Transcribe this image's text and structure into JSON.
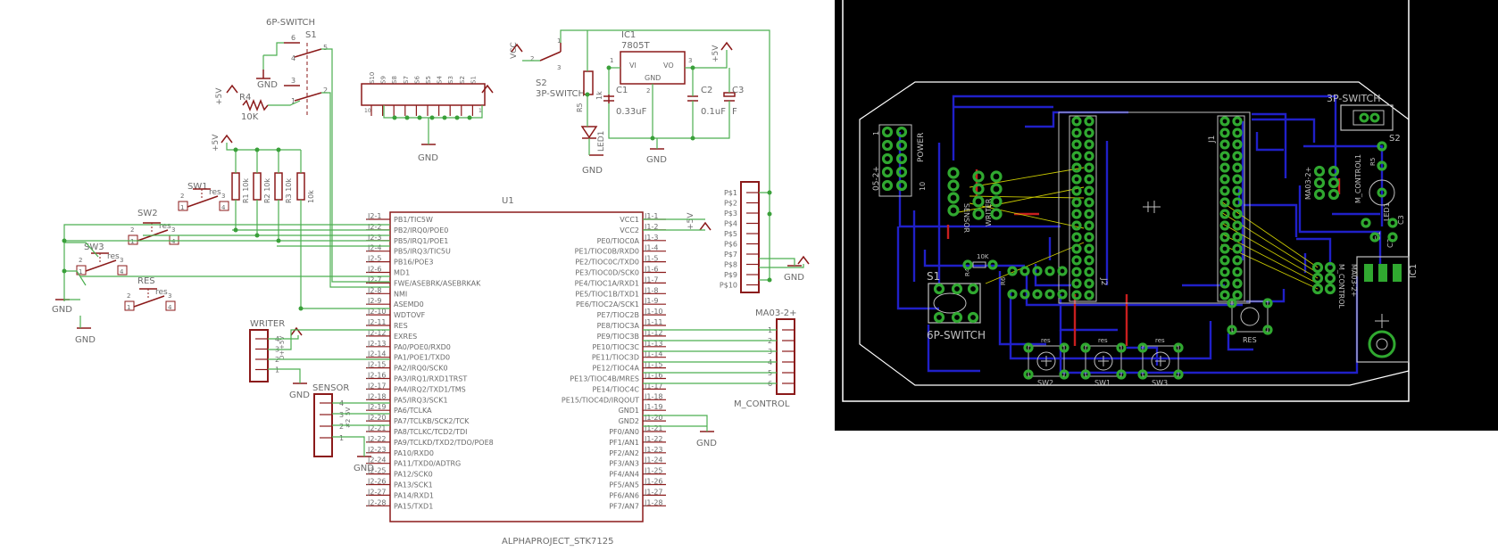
{
  "schematic": {
    "u1_ref": "U1",
    "u1_value": "ALPHAPROJECT_STK7125",
    "u1_left_pins": [
      {
        "num": "J2-1",
        "name": "PB1/TIC5W"
      },
      {
        "num": "J2-2",
        "name": "PB2/IRQ0/POE0"
      },
      {
        "num": "J2-3",
        "name": "PB5/IRQ1/POE1"
      },
      {
        "num": "J2-4",
        "name": "PB5/IRQ3/TIC5U"
      },
      {
        "num": "J2-5",
        "name": "PB16/POE3"
      },
      {
        "num": "J2-6",
        "name": "MD1"
      },
      {
        "num": "J2-7",
        "name": "FWE/ASEBRK/ASEBRKAK"
      },
      {
        "num": "J2-8",
        "name": "NMI"
      },
      {
        "num": "J2-9",
        "name": "ASEMD0"
      },
      {
        "num": "J2-10",
        "name": "WDTOVF"
      },
      {
        "num": "J2-11",
        "name": "RES"
      },
      {
        "num": "J2-12",
        "name": "EXRES"
      },
      {
        "num": "J2-13",
        "name": "PA0/POE0/RXD0"
      },
      {
        "num": "J2-14",
        "name": "PA1/POE1/TXD0"
      },
      {
        "num": "J2-15",
        "name": "PA2/IRQ0/SCK0"
      },
      {
        "num": "J2-16",
        "name": "PA3/IRQ1/RXD1TRST"
      },
      {
        "num": "J2-17",
        "name": "PA4/IRQ2/TXD1/TMS"
      },
      {
        "num": "J2-18",
        "name": "PA5/IRQ3/SCK1"
      },
      {
        "num": "J2-19",
        "name": "PA6/TCLKA"
      },
      {
        "num": "J2-20",
        "name": "PA7/TCLKB/SCK2/TCK"
      },
      {
        "num": "J2-21",
        "name": "PA8/TCLKC/TCD2/TDI"
      },
      {
        "num": "J2-22",
        "name": "PA9/TCLKD/TXD2/TDO/POE8"
      },
      {
        "num": "J2-23",
        "name": "PA10/RXD0"
      },
      {
        "num": "J2-24",
        "name": "PA11/TXD0/ADTRG"
      },
      {
        "num": "J2-25",
        "name": "PA12/SCK0"
      },
      {
        "num": "J2-26",
        "name": "PA13/SCK1"
      },
      {
        "num": "J2-27",
        "name": "PA14/RXD1"
      },
      {
        "num": "J2-28",
        "name": "PA15/TXD1"
      }
    ],
    "u1_right_pins": [
      {
        "num": "J1-1",
        "name": "VCC1"
      },
      {
        "num": "J1-2",
        "name": "VCC2"
      },
      {
        "num": "J1-3",
        "name": "PE0/TIOC0A"
      },
      {
        "num": "J1-4",
        "name": "PE1/TIOC0B/RXD0"
      },
      {
        "num": "J1-5",
        "name": "PE2/TIOC0C/TXD0"
      },
      {
        "num": "J1-6",
        "name": "PE3/TIOC0D/SCK0"
      },
      {
        "num": "J1-7",
        "name": "PE4/TIOC1A/RXD1"
      },
      {
        "num": "J1-8",
        "name": "PE5/TIOC1B/TXD1"
      },
      {
        "num": "J1-9",
        "name": "PE6/TIOC2A/SCK1"
      },
      {
        "num": "J1-10",
        "name": "PE7/TIOC2B"
      },
      {
        "num": "J1-11",
        "name": "PE8/TIOC3A"
      },
      {
        "num": "J1-12",
        "name": "PE9/TIOC3B"
      },
      {
        "num": "J1-13",
        "name": "PE10/TIOC3C"
      },
      {
        "num": "J1-14",
        "name": "PE11/TIOC3D"
      },
      {
        "num": "J1-15",
        "name": "PE12/TIOC4A"
      },
      {
        "num": "J1-16",
        "name": "PE13/TIOC4B/MRES"
      },
      {
        "num": "J1-17",
        "name": "PE14/TIOC4C"
      },
      {
        "num": "J1-18",
        "name": "PE15/TIOC4D/IRQOUT"
      },
      {
        "num": "J1-19",
        "name": "GND1"
      },
      {
        "num": "J1-20",
        "name": "GND2"
      },
      {
        "num": "J1-21",
        "name": "PF0/AN0"
      },
      {
        "num": "J1-22",
        "name": "PF1/AN1"
      },
      {
        "num": "J1-23",
        "name": "PF2/AN2"
      },
      {
        "num": "J1-24",
        "name": "PF3/AN3"
      },
      {
        "num": "J1-25",
        "name": "PF4/AN4"
      },
      {
        "num": "J1-26",
        "name": "PF5/AN5"
      },
      {
        "num": "J1-27",
        "name": "PF6/AN6"
      },
      {
        "num": "J1-28",
        "name": "PF7/AN7"
      }
    ],
    "s1_type": "6P-SWITCH",
    "s1_ref": "S1",
    "s1_pins": [
      "6",
      "4",
      "5",
      "3",
      "1",
      "2"
    ],
    "r4_ref": "R4",
    "r4_value": "10K",
    "ic1_ref": "IC1",
    "ic1_value": "7805T",
    "ic1_vi": "VI",
    "ic1_vo": "VO",
    "ic1_gnd": "GND",
    "ic1_pins": [
      "1",
      "3",
      "2"
    ],
    "s2_ref": "S2",
    "s2_type": "3P-SWITCH",
    "s2_pins": [
      "1",
      "2",
      "3"
    ],
    "c1_ref": "C1",
    "c1_value": "0.33uF",
    "c2_ref": "C2",
    "c2_value": "0.1uF",
    "c3_ref": "C3",
    "c3_value": "F",
    "r5_ref": "R5",
    "r5_value": "1k",
    "led_ref": "LED1",
    "vcc": "VCC",
    "plus5": "+5V",
    "gnd": "GND",
    "sw1": "SW1",
    "sw2": "SW2",
    "sw3": "SW3",
    "res": "RES",
    "res_small": "res",
    "sw_pins": [
      "1",
      "2",
      "3",
      "4"
    ],
    "pullups": [
      "R1 10k",
      "R2 10k",
      "R3 10k",
      "10k"
    ],
    "writer": "WRITER",
    "writer_pins": [
      "4",
      "3",
      "2",
      "1"
    ],
    "writer_small": [
      "+5V",
      "D+"
    ],
    "sensor": "SENSOR",
    "sensor_pins": [
      "4",
      "3",
      "2",
      "1"
    ],
    "sensor_small": [
      "5V",
      "#2"
    ],
    "ma03": "MA03-2+",
    "ma03_pins": [
      "1",
      "2",
      "3",
      "4",
      "5",
      "6"
    ],
    "mcontrol": "M_CONTROL",
    "power_conn_pins": [
      "P$1",
      "P$2",
      "P$3",
      "P$4",
      "P$5",
      "P$6",
      "P$7",
      "P$8",
      "P$9",
      "P$10"
    ],
    "top_conn_pins": [
      "S10",
      "S9",
      "S8",
      "S7",
      "S6",
      "S5",
      "S4",
      "S3",
      "S2",
      "S1"
    ],
    "top_conn_nums": [
      "10",
      "1"
    ]
  },
  "board": {
    "labels": {
      "sw3p": "3P-SWITCH",
      "sw6p": "6P-SWITCH",
      "s1": "S1",
      "s2": "S2",
      "ic1": "IC1",
      "j1": "J1",
      "j2": "J2",
      "power": "POWER",
      "pwr_conn": "05-2+",
      "writer": "WRITER",
      "sensor": "SENSOR",
      "ma03": "MA03-2+",
      "mcontrol": "M_CONTROL1",
      "mcontrol_flip": "M_CONTROL",
      "ma03_flip": "MA03-2+",
      "r10k": "10K",
      "res": "RES",
      "sw1": "SW1",
      "sw2": "SW2",
      "sw3": "SW3",
      "res_small": "res",
      "pin_1": "1",
      "pin_10": "10",
      "r4": "R4",
      "r5": "R5",
      "r6": "R6",
      "c1": "C1",
      "c2": "C2",
      "c3": "C3",
      "led": "LED1"
    },
    "colors": {
      "background": "#000000",
      "outline": "#ffffff",
      "trace_bottom": "#2020c8",
      "trace_top": "#c81e1e",
      "airwire": "#c8c800",
      "pad": "#30a830",
      "silk": "#c0c0c0"
    }
  },
  "colors": {
    "wire": "#4caf50",
    "symbol": "#8b1a1a",
    "text": "#6a6a6a",
    "junction": "#3aa03a"
  }
}
